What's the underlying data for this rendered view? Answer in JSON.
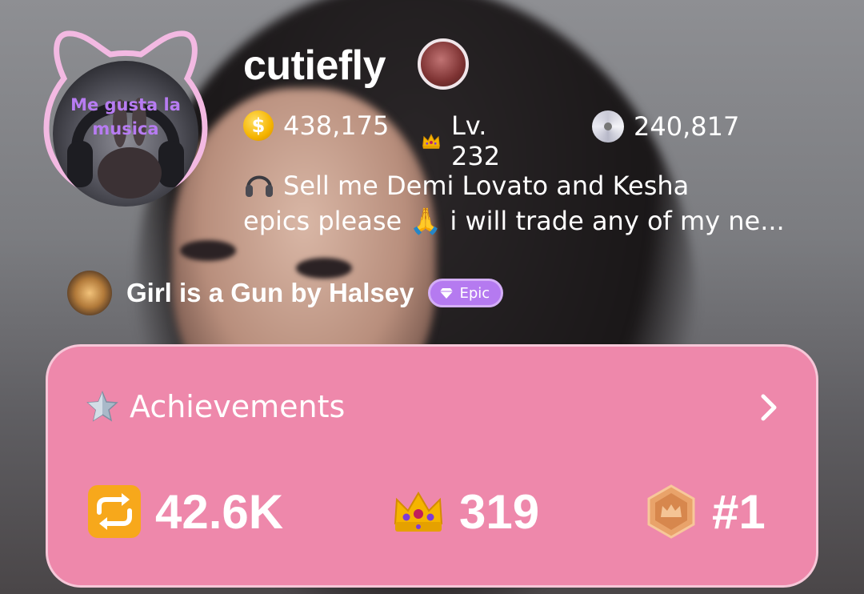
{
  "profile": {
    "username": "cutiefly",
    "avatar_text": "Me gusta la musica",
    "stats": {
      "coins": "438,175",
      "level": "Lv. 232",
      "discs": "240,817"
    },
    "bio_line1": "Sell me Demi Lovato and Kesha",
    "bio_line2": "epics please 🙏 i will trade any of my ne..."
  },
  "now_playing": {
    "title": "Girl is a Gun by Halsey",
    "rarity": "Epic"
  },
  "achievements": {
    "title": "Achievements",
    "items": [
      {
        "icon": "repeat-icon",
        "value": "42.6K"
      },
      {
        "icon": "crown-icon",
        "value": "319"
      },
      {
        "icon": "rank-badge-icon",
        "value": "#1"
      }
    ]
  },
  "colors": {
    "card_bg": "#ee88ab",
    "card_border": "#f6c7d8",
    "badge_purple": "#b57af0",
    "avatar_ring": "#f3b9e2"
  }
}
